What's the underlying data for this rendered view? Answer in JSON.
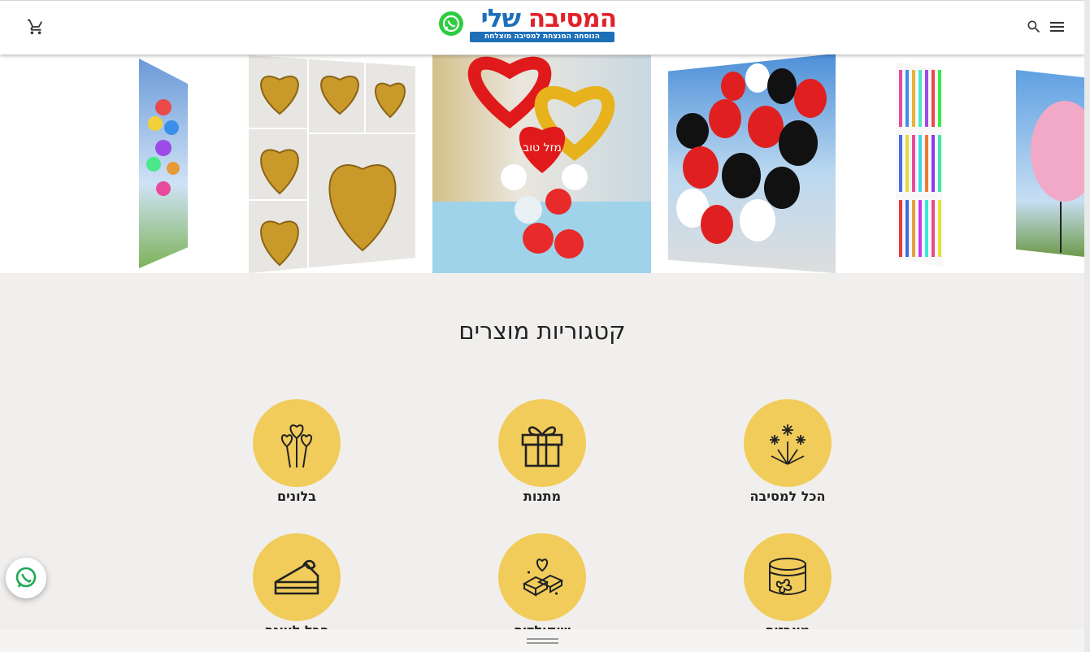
{
  "header": {
    "logo_title_red": "המסיבה",
    "logo_title_blue": "שלי",
    "logo_tagline": "הנוסחה המנצחת למסיבה מוצלחת"
  },
  "icons": {
    "cart": "cart-icon",
    "search": "search-icon",
    "menu": "menu-icon",
    "whatsapp": "whatsapp-icon"
  },
  "carousel": {
    "slides": [
      "balloon-bouquet",
      "chocolate-hearts",
      "heart-balloons",
      "black-red-balloons",
      "sparkler-candles",
      "pink-balloon"
    ],
    "center_balloon_text": "מזל טוב"
  },
  "categories": {
    "title": "קטגוריות מוצרים",
    "items": [
      {
        "label": "הכל למסיבה",
        "icon": "fireworks-icon"
      },
      {
        "label": "מתנות",
        "icon": "gift-icon"
      },
      {
        "label": "בלונים",
        "icon": "balloons-icon"
      },
      {
        "label": "מארזים",
        "icon": "gift-box-icon"
      },
      {
        "label": "שוקולדים",
        "icon": "chocolate-icon"
      },
      {
        "label": "הכל לעוגה",
        "icon": "cake-icon"
      }
    ]
  },
  "colors": {
    "accent_yellow": "#f1cc5b",
    "brand_red": "#e0232a",
    "brand_blue": "#1d6fb8",
    "whatsapp_green": "#2ecc40",
    "background": "#f1efed"
  }
}
